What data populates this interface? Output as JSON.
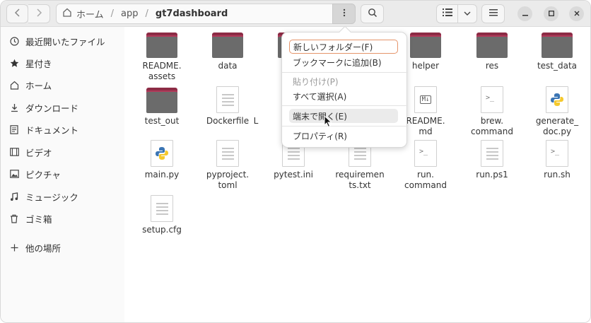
{
  "toolbar": {
    "back_icon": "chevron-left-icon",
    "forward_icon": "chevron-right-icon",
    "path": {
      "home_label": "ホーム",
      "sep1": "/",
      "seg1": "app",
      "sep2": "/",
      "current": "gt7dashboard"
    },
    "menu_icon": "vertical-dots-icon",
    "search_icon": "search-icon",
    "view_icon": "list-view-icon",
    "view_dropdown_icon": "chevron-down-icon",
    "hamburger_icon": "hamburger-menu-icon"
  },
  "sidebar": {
    "items": [
      {
        "label": "最近開いたファイル",
        "icon": "clock-icon"
      },
      {
        "label": "星付き",
        "icon": "star-icon"
      },
      {
        "label": "ホーム",
        "icon": "home-icon"
      },
      {
        "label": "ダウンロード",
        "icon": "download-icon"
      },
      {
        "label": "ドキュメント",
        "icon": "document-icon"
      },
      {
        "label": "ビデオ",
        "icon": "video-icon"
      },
      {
        "label": "ピクチャ",
        "icon": "picture-icon"
      },
      {
        "label": "ミュージック",
        "icon": "music-icon"
      },
      {
        "label": "ゴミ箱",
        "icon": "trash-icon"
      },
      {
        "label": "他の場所",
        "icon": "plus-icon"
      }
    ]
  },
  "files": [
    {
      "name": "README.\nassets",
      "kind": "folder"
    },
    {
      "name": "data",
      "kind": "folder"
    },
    {
      "name": "helper",
      "kind": "folder"
    },
    {
      "name": "res",
      "kind": "folder"
    },
    {
      "name": "test_data",
      "kind": "folder"
    },
    {
      "name": "test_out",
      "kind": "folder"
    },
    {
      "name": "Dockerfile",
      "kind": "text"
    },
    {
      "name": "L",
      "kind": "text"
    },
    {
      "name": "README.\nmd",
      "kind": "markdown"
    },
    {
      "name": "brew.\ncommand",
      "kind": "script"
    },
    {
      "name": "generate_\ndoc.py",
      "kind": "python"
    },
    {
      "name": "main.py",
      "kind": "python"
    },
    {
      "name": "pyproject.\ntoml",
      "kind": "text"
    },
    {
      "name": "pytest.ini",
      "kind": "text"
    },
    {
      "name": "requiremen\nts.txt",
      "kind": "text"
    },
    {
      "name": "run.\ncommand",
      "kind": "script"
    },
    {
      "name": "run.ps1",
      "kind": "text"
    },
    {
      "name": "run.sh",
      "kind": "script"
    },
    {
      "name": "setup.cfg",
      "kind": "text"
    }
  ],
  "context_menu": {
    "items": [
      {
        "label": "新しいフォルダー(F)",
        "state": "focused"
      },
      {
        "label": "ブックマークに追加(B)",
        "state": "normal"
      },
      {
        "label": "貼り付け(P)",
        "state": "disabled"
      },
      {
        "label": "すべて選択(A)",
        "state": "normal"
      },
      {
        "label": "端末で開く(E)",
        "state": "hover"
      },
      {
        "label": "プロパティ(R)",
        "state": "normal"
      }
    ]
  },
  "colors": {
    "folder_tab": "#8d2b45",
    "folder_body": "#6b6b6b",
    "menu_focus_border": "#e5946a",
    "python_blue": "#3b75b4",
    "python_yellow": "#f5c92d"
  }
}
